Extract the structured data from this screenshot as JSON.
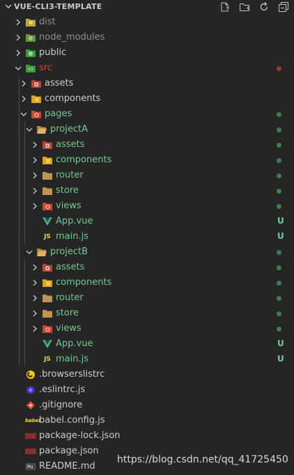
{
  "explorer": {
    "title": "VUE-CLI3-TEMPLATE",
    "actions": [
      "new-file-icon",
      "new-folder-icon",
      "refresh-icon",
      "collapse-all-icon"
    ]
  },
  "tree": [
    {
      "label": "dist",
      "depth": 0,
      "kind": "folder",
      "expanded": false,
      "icon": "folder-dist-icon",
      "color": "#8f8f8f"
    },
    {
      "label": "node_modules",
      "depth": 0,
      "kind": "folder",
      "expanded": false,
      "icon": "folder-node-icon",
      "color": "#8f8f8f"
    },
    {
      "label": "public",
      "depth": 0,
      "kind": "folder",
      "expanded": false,
      "icon": "folder-public-icon",
      "color": "#cccccc"
    },
    {
      "label": "src",
      "depth": 0,
      "kind": "folder",
      "expanded": true,
      "icon": "folder-src-icon",
      "color": "#c74e39",
      "status": "dot",
      "status_color": "#8c3b2e"
    },
    {
      "label": "assets",
      "depth": 1,
      "kind": "folder",
      "expanded": false,
      "icon": "folder-assets-icon",
      "color": "#cccccc"
    },
    {
      "label": "components",
      "depth": 1,
      "kind": "folder",
      "expanded": false,
      "icon": "folder-components-icon",
      "color": "#cccccc"
    },
    {
      "label": "pages",
      "depth": 1,
      "kind": "folder",
      "expanded": true,
      "icon": "folder-views-icon",
      "color": "#73c991",
      "status": "dot",
      "status_color": "#3f7d4f"
    },
    {
      "label": "projectA",
      "depth": 2,
      "kind": "folder",
      "expanded": true,
      "icon": "folder-open-icon",
      "color": "#73c991",
      "status": "dot",
      "status_color": "#3f7d4f"
    },
    {
      "label": "assets",
      "depth": 3,
      "kind": "folder",
      "expanded": false,
      "icon": "folder-assets-icon",
      "color": "#73c991",
      "status": "dot",
      "status_color": "#3f7d4f"
    },
    {
      "label": "components",
      "depth": 3,
      "kind": "folder",
      "expanded": false,
      "icon": "folder-components-icon",
      "color": "#73c991",
      "status": "dot",
      "status_color": "#3f7d4f"
    },
    {
      "label": "router",
      "depth": 3,
      "kind": "folder",
      "expanded": false,
      "icon": "folder-icon",
      "color": "#73c991",
      "status": "dot",
      "status_color": "#3f7d4f"
    },
    {
      "label": "store",
      "depth": 3,
      "kind": "folder",
      "expanded": false,
      "icon": "folder-icon",
      "color": "#73c991",
      "status": "dot",
      "status_color": "#3f7d4f"
    },
    {
      "label": "views",
      "depth": 3,
      "kind": "folder",
      "expanded": false,
      "icon": "folder-views-icon",
      "color": "#73c991",
      "status": "dot",
      "status_color": "#3f7d4f"
    },
    {
      "label": "App.vue",
      "depth": 3,
      "kind": "file",
      "icon": "vue-icon",
      "color": "#73c991",
      "status": "badge",
      "badge": "U"
    },
    {
      "label": "main.js",
      "depth": 3,
      "kind": "file",
      "icon": "js-icon",
      "color": "#73c991",
      "status": "badge",
      "badge": "U"
    },
    {
      "label": "projectB",
      "depth": 2,
      "kind": "folder",
      "expanded": true,
      "icon": "folder-open-icon",
      "color": "#73c991",
      "status": "dot",
      "status_color": "#3f7d4f"
    },
    {
      "label": "assets",
      "depth": 3,
      "kind": "folder",
      "expanded": false,
      "icon": "folder-assets-icon",
      "color": "#73c991",
      "status": "dot",
      "status_color": "#3f7d4f"
    },
    {
      "label": "components",
      "depth": 3,
      "kind": "folder",
      "expanded": false,
      "icon": "folder-components-icon",
      "color": "#73c991",
      "status": "dot",
      "status_color": "#3f7d4f"
    },
    {
      "label": "router",
      "depth": 3,
      "kind": "folder",
      "expanded": false,
      "icon": "folder-icon",
      "color": "#73c991",
      "status": "dot",
      "status_color": "#3f7d4f"
    },
    {
      "label": "store",
      "depth": 3,
      "kind": "folder",
      "expanded": false,
      "icon": "folder-icon",
      "color": "#73c991",
      "status": "dot",
      "status_color": "#3f7d4f"
    },
    {
      "label": "views",
      "depth": 3,
      "kind": "folder",
      "expanded": false,
      "icon": "folder-views-icon",
      "color": "#73c991",
      "status": "dot",
      "status_color": "#3f7d4f"
    },
    {
      "label": "App.vue",
      "depth": 3,
      "kind": "file",
      "icon": "vue-icon",
      "color": "#73c991",
      "status": "badge",
      "badge": "U"
    },
    {
      "label": "main.js",
      "depth": 3,
      "kind": "file",
      "icon": "js-icon",
      "color": "#73c991",
      "status": "badge",
      "badge": "U"
    },
    {
      "label": ".browserslistrc",
      "depth": 0,
      "kind": "file",
      "icon": "browserslist-icon",
      "color": "#cccccc"
    },
    {
      "label": ".eslintrc.js",
      "depth": 0,
      "kind": "file",
      "icon": "eslint-icon",
      "color": "#cccccc"
    },
    {
      "label": ".gitignore",
      "depth": 0,
      "kind": "file",
      "icon": "git-icon",
      "color": "#cccccc"
    },
    {
      "label": "babel.config.js",
      "depth": 0,
      "kind": "file",
      "icon": "babel-icon",
      "color": "#cccccc"
    },
    {
      "label": "package-lock.json",
      "depth": 0,
      "kind": "file",
      "icon": "npm-icon",
      "color": "#cccccc"
    },
    {
      "label": "package.json",
      "depth": 0,
      "kind": "file",
      "icon": "npm-icon",
      "color": "#cccccc"
    },
    {
      "label": "README.md",
      "depth": 0,
      "kind": "file",
      "icon": "readme-icon",
      "color": "#cccccc"
    }
  ],
  "watermark": "https://blog.csdn.net/qq_41725450"
}
